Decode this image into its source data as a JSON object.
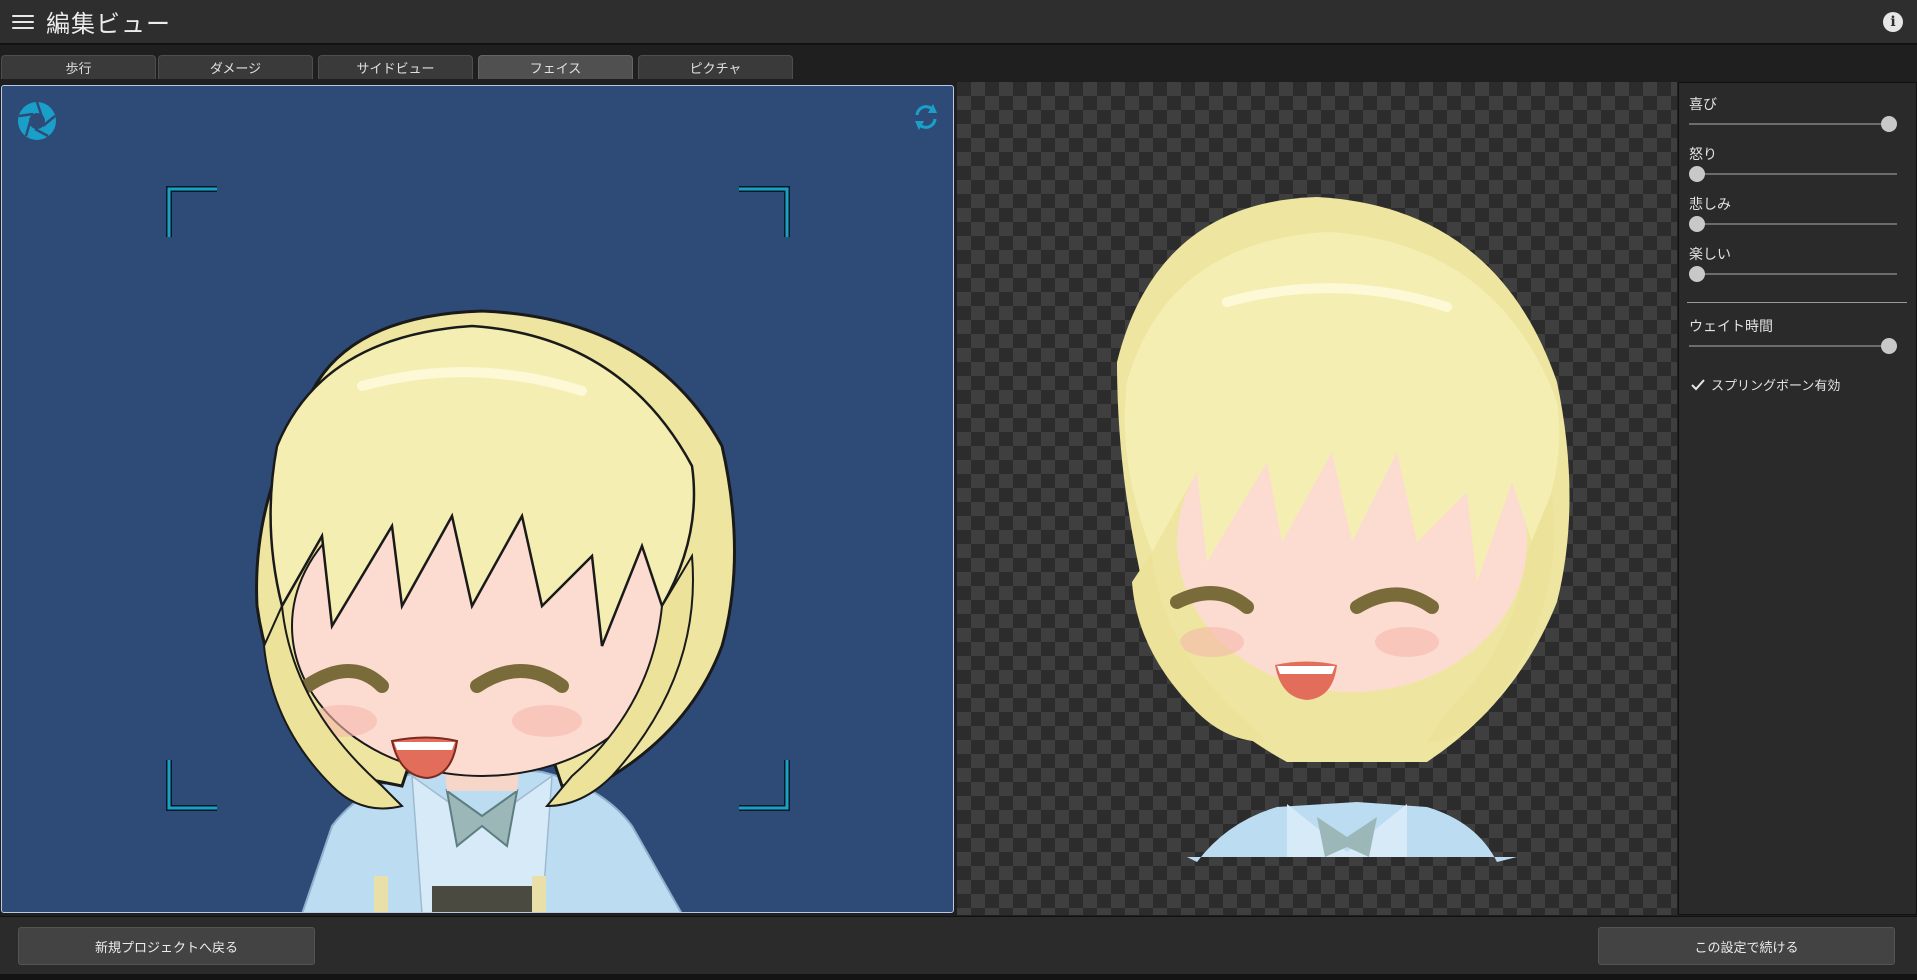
{
  "header": {
    "title": "編集ビュー",
    "menu_icon": "hamburger-menu-icon",
    "info_icon": "info-icon"
  },
  "tabs": [
    {
      "label": "歩行",
      "active": false
    },
    {
      "label": "ダメージ",
      "active": false
    },
    {
      "label": "サイドビュー",
      "active": false
    },
    {
      "label": "フェイス",
      "active": true
    },
    {
      "label": "ピクチャ",
      "active": false
    }
  ],
  "viewport": {
    "background_color": "#2e4b78",
    "capture_icon": "camera-shutter-icon",
    "rotate_icon": "refresh-icon",
    "accent_color": "#1aa0c8"
  },
  "preview": {
    "background": "transparency-checkerboard"
  },
  "sliders": {
    "joy": {
      "label": "喜び",
      "value": 1.0
    },
    "anger": {
      "label": "怒り",
      "value": 0.0
    },
    "sadness": {
      "label": "悲しみ",
      "value": 0.0
    },
    "fun": {
      "label": "楽しい",
      "value": 0.0
    },
    "wait": {
      "label": "ウェイト時間",
      "value": 1.0
    }
  },
  "spring_bone": {
    "label": "スプリングボーン有効",
    "checked": true
  },
  "footer": {
    "back_label": "新規プロジェクトへ戻る",
    "continue_label": "この設定で続ける"
  }
}
